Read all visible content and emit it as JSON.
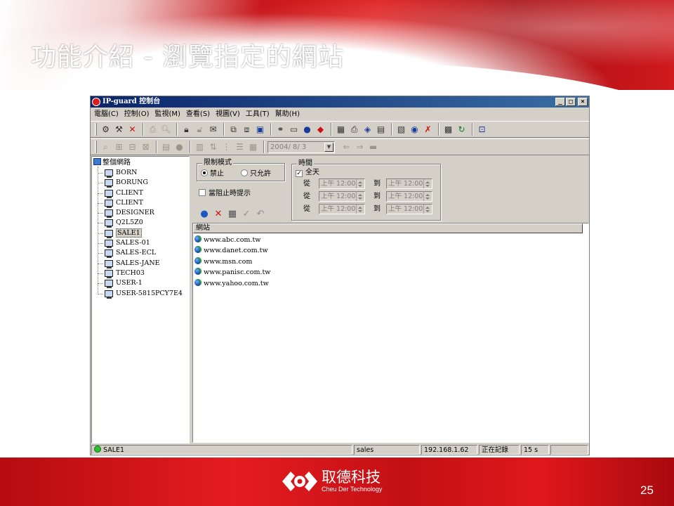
{
  "slide": {
    "title": "功能介紹 - 瀏覽指定的網站",
    "company_name": "取德科技",
    "company_en": "Cheu Der Technology",
    "page_number": "25"
  },
  "window": {
    "title": "IP-guard 控制台",
    "buttons": {
      "minimize": "_",
      "maximize": "□",
      "close": "×"
    }
  },
  "menu": [
    "電腦(C)",
    "控制(O)",
    "監視(M)",
    "查看(S)",
    "視圖(V)",
    "工具(T)",
    "幫助(H)"
  ],
  "toolbar2": {
    "date_value": "2004/ 8/ 3"
  },
  "tree": {
    "root": "整個網路",
    "items": [
      "BORN",
      "BORUNG",
      "CLIENT",
      "CLIENT",
      "DESIGNER",
      "Q2L5Z0",
      "SALE1",
      "SALES-01",
      "SALES-ECL",
      "SALES-JANE",
      "TECH03",
      "USER-1",
      "USER-5815PCY7E4"
    ],
    "selected": "SALE1"
  },
  "restriction": {
    "group_title": "限制模式",
    "option_block": "禁止",
    "option_allow": "只允許",
    "selected": "禁止",
    "notify_label": "當阻止時提示",
    "notify_checked": false
  },
  "time": {
    "group_title": "時間",
    "all_day_label": "全天",
    "all_day_checked": true,
    "from_label": "從",
    "to_label": "到",
    "rows": [
      {
        "from": "上午 12:00",
        "to": "上午 12:00"
      },
      {
        "from": "上午 12:00",
        "to": "上午 12:00"
      },
      {
        "from": "上午 12:00",
        "to": "上午 12:00"
      }
    ]
  },
  "sites": {
    "column_header": "網站",
    "rows": [
      "www.abc.com.tw",
      "www.danet.com.tw",
      "www.msn.com",
      "www.panisc.com.tw",
      "www.yahoo.com.tw"
    ]
  },
  "status": {
    "computer": "SALE1",
    "user": "sales",
    "ip": "192.168.1.62",
    "state": "正在記錄",
    "interval": "15 s"
  }
}
